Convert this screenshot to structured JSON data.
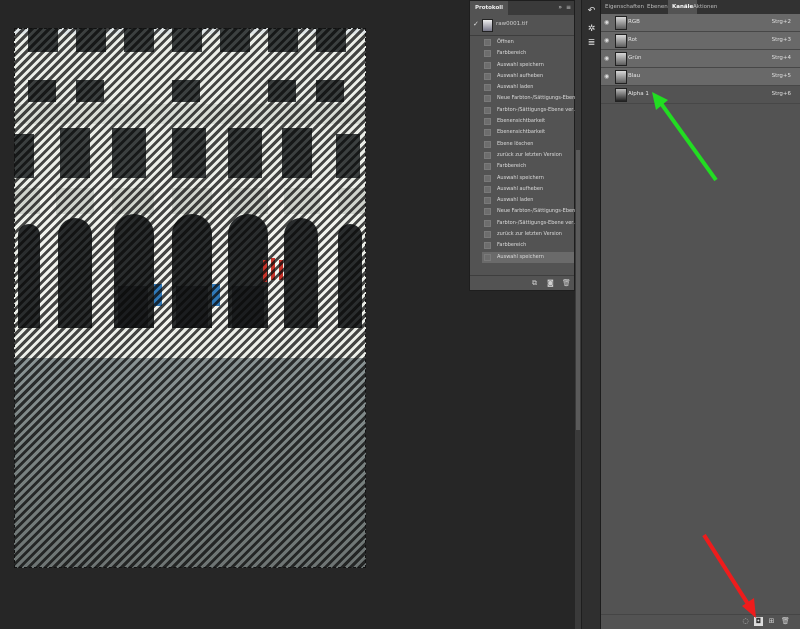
{
  "history_panel": {
    "tab_label": "Protokoll",
    "collapse_glyph": "»",
    "menu_glyph": "≡",
    "snapshot_label": "raw0001.tif",
    "items": [
      "Öffnen",
      "Farbbereich",
      "Auswahl speichern",
      "Auswahl aufheben",
      "Auswahl laden",
      "Neue Farbton-/Sättigungs-Ebene",
      "Farbton-/Sättigungs-Ebene ver…",
      "Ebenensichtbarkeit",
      "Ebenensichtbarkeit",
      "Ebene löschen",
      "zurück zur letzten Version",
      "Farbbereich",
      "Auswahl speichern",
      "Auswahl aufheben",
      "Auswahl laden",
      "Neue Farbton-/Sättigungs-Ebene",
      "Farbton-/Sättigungs-Ebene ver…",
      "zurück zur letzten Version",
      "Farbbereich",
      "Auswahl speichern"
    ],
    "active_index": 19
  },
  "right_panel": {
    "tabs": [
      "Eigenschaften",
      "Ebenen",
      "Kanäle",
      "Aktionen"
    ],
    "active_tab": 2,
    "channels": [
      {
        "name": "RGB",
        "shortcut": "Strg+2",
        "visible": true
      },
      {
        "name": "Rot",
        "shortcut": "Strg+3",
        "visible": true
      },
      {
        "name": "Grün",
        "shortcut": "Strg+4",
        "visible": true
      },
      {
        "name": "Blau",
        "shortcut": "Strg+5",
        "visible": true
      },
      {
        "name": "Alpha 1",
        "shortcut": "Strg+6",
        "visible": false
      }
    ]
  },
  "annotations": {
    "green_arrow_color": "#22dd22",
    "red_arrow_color": "#ee1c1c"
  },
  "colors": {
    "workspace_bg": "#262626",
    "panel_bg": "#535353",
    "selected_row": "#696969"
  },
  "icons": {
    "eye": "eye-icon",
    "brush": "history-brush-icon",
    "new_snapshot": "camera-icon",
    "trash": "trash-icon",
    "save_selection_channel": "save-selection-as-channel-icon",
    "load_channel_selection": "load-channel-as-selection-icon"
  }
}
